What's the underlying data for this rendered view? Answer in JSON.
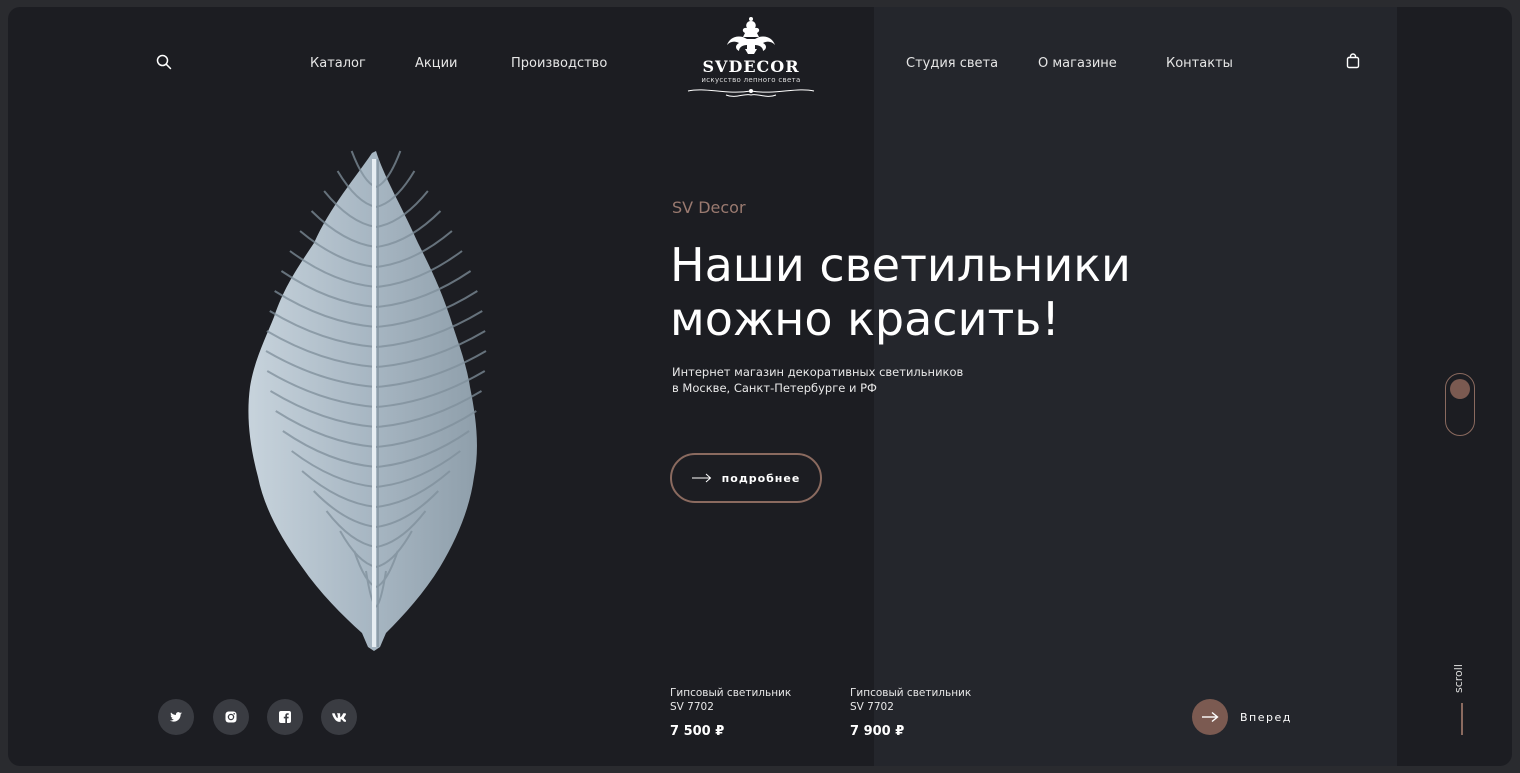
{
  "header": {
    "nav_left": [
      "Каталог",
      "Акции",
      "Производство"
    ],
    "nav_right": [
      "Студия света",
      "О магазине",
      "Контакты"
    ],
    "logo": {
      "title": "SVDECOR",
      "subtitle": "искусство лепного света"
    },
    "search_icon": "search-icon",
    "cart_icon": "shopping-bag-icon"
  },
  "hero": {
    "kicker": "SV Decor",
    "headline": [
      "Наши светильники",
      "можно красить!"
    ],
    "description": [
      "Интернет магазин декоративных светильников",
      "в Москве, Санкт-Петербурге и РФ"
    ],
    "button_label": "подробнее"
  },
  "social": [
    "twitter-icon",
    "instagram-icon",
    "facebook-icon",
    "vk-icon"
  ],
  "products": [
    {
      "name": "Гипсовый светильник",
      "code": "SV 7702",
      "price": "7 500 ₽"
    },
    {
      "name": "Гипсовый светильник",
      "code": "SV 7702",
      "price": "7 900 ₽"
    }
  ],
  "forward_label": "Вперед",
  "scroll_label": "scroll",
  "colors": {
    "background": "#1c1d22",
    "panel": "#24262c",
    "accent": "#7b5a51",
    "accent_text": "#9a7a70"
  }
}
